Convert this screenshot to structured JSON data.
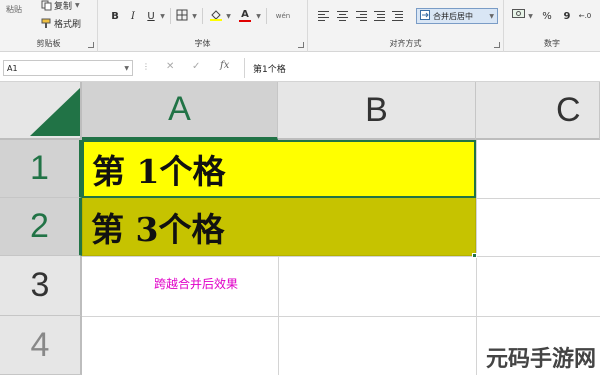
{
  "ribbon": {
    "clipboard": {
      "group_label": "剪贴板",
      "paste_label": "粘贴",
      "copy_label": "复制",
      "format_painter_label": "格式刷"
    },
    "font": {
      "group_label": "字体",
      "bold": "B",
      "italic": "I",
      "underline": "U",
      "font_color_glyph": "A",
      "wen_glyph": "wén"
    },
    "alignment": {
      "group_label": "对齐方式",
      "merge_center_label": "合并后居中"
    },
    "number": {
      "group_label": "数字",
      "percent": "%",
      "comma": "9"
    }
  },
  "formula_bar": {
    "name_box": "A1",
    "fx_label": "fx",
    "formula": "第1个格"
  },
  "grid": {
    "columns": [
      "A",
      "B",
      "C"
    ],
    "rows": [
      "1",
      "2",
      "3",
      "4"
    ],
    "cells": {
      "A1": "第 1个格",
      "A2": "第 3个格",
      "note": "跨越合并后效果"
    },
    "colors": {
      "a1_fill": "#ffff00",
      "a2_fill": "#c6c300",
      "selection": "#217346",
      "note_text": "#e000c8"
    }
  },
  "watermark": "元码手游网"
}
